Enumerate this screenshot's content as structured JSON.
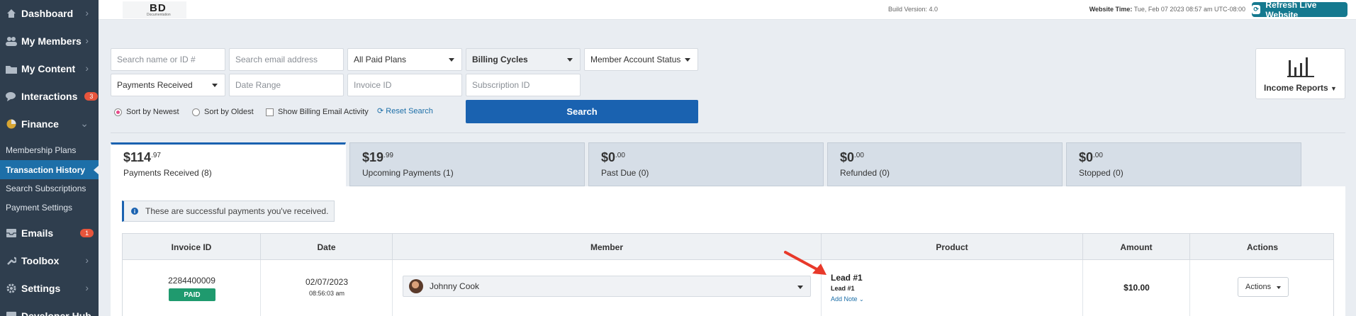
{
  "sidebar": {
    "items": [
      {
        "label": "Dashboard",
        "icon": "dashboard-icon"
      },
      {
        "label": "My Members",
        "icon": "members-icon"
      },
      {
        "label": "My Content",
        "icon": "content-icon"
      },
      {
        "label": "Interactions",
        "icon": "interactions-icon",
        "badge": "3"
      },
      {
        "label": "Finance",
        "icon": "finance-icon"
      },
      {
        "label": "Emails",
        "icon": "emails-icon",
        "badge": "1"
      },
      {
        "label": "Toolbox",
        "icon": "toolbox-icon"
      },
      {
        "label": "Settings",
        "icon": "settings-icon"
      },
      {
        "label": "Developer Hub",
        "icon": "developer-icon"
      }
    ],
    "finance_sub": [
      "Membership Plans",
      "Transaction History",
      "Search Subscriptions",
      "Payment Settings"
    ]
  },
  "topbar": {
    "logo_mark": "BD",
    "logo_sub": "Documentation",
    "build": "Build Version: 4.0",
    "website_time_label": "Website Time:",
    "website_time": "Tue, Feb 07 2023 08:57 am UTC-08:00",
    "refresh_label": "Refresh Live Website"
  },
  "filters": {
    "search_name_placeholder": "Search name or ID #",
    "search_email_placeholder": "Search email address",
    "paid_plans": "All Paid Plans",
    "billing_cycles": "Billing Cycles",
    "account_status": "Member Account Status",
    "payments_received": "Payments Received",
    "date_range_placeholder": "Date Range",
    "invoice_placeholder": "Invoice ID",
    "subscription_placeholder": "Subscription ID",
    "sort_newest": "Sort by Newest",
    "sort_oldest": "Sort by Oldest",
    "show_billing": "Show Billing Email Activity",
    "reset": "Reset Search",
    "search": "Search",
    "income_reports": "Income Reports"
  },
  "tabs": [
    {
      "dollars": "$114",
      "cents": ".97",
      "label": "Payments Received (8)"
    },
    {
      "dollars": "$19",
      "cents": ".99",
      "label": "Upcoming Payments (1)"
    },
    {
      "dollars": "$0",
      "cents": ".00",
      "label": "Past Due (0)"
    },
    {
      "dollars": "$0",
      "cents": ".00",
      "label": "Refunded (0)"
    },
    {
      "dollars": "$0",
      "cents": ".00",
      "label": "Stopped (0)"
    }
  ],
  "info_text": "These are successful payments you've received.",
  "table": {
    "headers": [
      "Invoice ID",
      "Date",
      "Member",
      "Product",
      "Amount",
      "Actions"
    ],
    "row": {
      "invoice_id": "2284400009",
      "status": "PAID",
      "date": "02/07/2023",
      "time": "08:56:03 am",
      "member": "Johnny Cook",
      "product_title": "Lead #1",
      "product_sub": "Lead #1",
      "add_note": "Add Note",
      "amount": "$10.00",
      "actions": "Actions"
    }
  },
  "colors": {
    "sidebar_bg": "#2f3e4e",
    "accent_blue": "#1a62b0",
    "refresh_teal": "#15798f",
    "paid_green": "#1f9a6e",
    "badge_red": "#e8553c",
    "arrow_red": "#e8392a"
  }
}
